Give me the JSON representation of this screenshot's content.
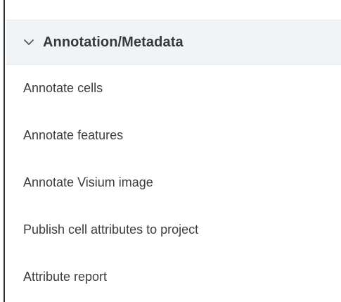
{
  "section": {
    "title": "Annotation/Metadata",
    "icon": "chevron-down-icon"
  },
  "menu": {
    "items": [
      {
        "label": "Annotate cells"
      },
      {
        "label": "Annotate features"
      },
      {
        "label": "Annotate Visium image"
      },
      {
        "label": "Publish cell attributes to project"
      },
      {
        "label": "Attribute report"
      }
    ]
  },
  "colors": {
    "header_bg": "#f1f4f7",
    "text": "#3c3c3c",
    "rule": "#2b2b2b"
  }
}
